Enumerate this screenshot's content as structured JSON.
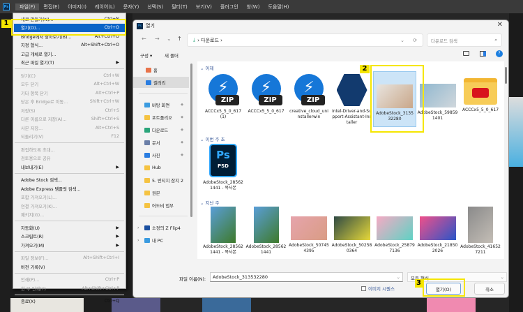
{
  "app": {
    "logo": "Ps"
  },
  "menubar": [
    "파일(F)",
    "편집(E)",
    "이미지(I)",
    "레이어(L)",
    "문자(Y)",
    "선택(S)",
    "필터(T)",
    "보기(V)",
    "플러그인",
    "창(W)",
    "도움말(H)"
  ],
  "file_menu": [
    {
      "label": "새로 만들기(N)...",
      "shortcut": "Ctrl+N"
    },
    {
      "label": "열기(O)...",
      "shortcut": "Ctrl+O",
      "highlighted": true
    },
    {
      "label": "Bridge에서 찾아보기(B)...",
      "shortcut": "Alt+Ctrl+O"
    },
    {
      "label": "지정 형식...",
      "shortcut": "Alt+Shift+Ctrl+O"
    },
    {
      "label": "고급 개체로 열기..."
    },
    {
      "label": "최근 파일 열기(T)",
      "submenu": true
    },
    {
      "divider": true
    },
    {
      "label": "닫기(C)",
      "shortcut": "Ctrl+W",
      "disabled": true
    },
    {
      "label": "모두 닫기",
      "shortcut": "Alt+Ctrl+W",
      "disabled": true
    },
    {
      "label": "기타 항목 닫기",
      "shortcut": "Alt+Ctrl+P",
      "disabled": true
    },
    {
      "label": "닫은 후 Bridge로 이동...",
      "shortcut": "Shift+Ctrl+W",
      "disabled": true
    },
    {
      "label": "저장(S)",
      "shortcut": "Ctrl+S",
      "disabled": true
    },
    {
      "label": "다른 이름으로 저장(A)...",
      "shortcut": "Shift+Ctrl+S",
      "disabled": true
    },
    {
      "label": "사본 저장...",
      "shortcut": "Alt+Ctrl+S",
      "disabled": true
    },
    {
      "label": "되돌리기(V)",
      "shortcut": "F12",
      "disabled": true
    },
    {
      "divider": true
    },
    {
      "label": "편집하도록 초대...",
      "disabled": true
    },
    {
      "label": "검토용으로 공유",
      "disabled": true
    },
    {
      "label": "내보내기(E)",
      "submenu": true
    },
    {
      "divider": true
    },
    {
      "label": "Adobe Stock 검색..."
    },
    {
      "label": "Adobe Express 템플릿 검색..."
    },
    {
      "label": "포함 가져오기(L)...",
      "disabled": true
    },
    {
      "label": "연결 가져오기(K)...",
      "disabled": true
    },
    {
      "label": "패키지(G)...",
      "disabled": true
    },
    {
      "divider": true
    },
    {
      "label": "자동화(U)",
      "submenu": true
    },
    {
      "label": "스크립트(R)",
      "submenu": true
    },
    {
      "label": "가져오기(M)",
      "submenu": true
    },
    {
      "divider": true
    },
    {
      "label": "파일 정보(F)...",
      "shortcut": "Alt+Shift+Ctrl+I",
      "disabled": true
    },
    {
      "label": "버전 기록(V)"
    },
    {
      "divider": true
    },
    {
      "label": "인쇄(P)...",
      "shortcut": "Ctrl+P",
      "disabled": true
    },
    {
      "label": "한 부 인쇄(Y)",
      "shortcut": "Alt+Shift+Ctrl+P",
      "disabled": true
    },
    {
      "divider": true
    },
    {
      "label": "종료(X)",
      "shortcut": "Ctrl+Q"
    }
  ],
  "steps": [
    "1",
    "2",
    "3"
  ],
  "dialog": {
    "title": "열기",
    "close": "✕",
    "nav": {
      "back": "←",
      "forward": "→",
      "recent": "⌄",
      "up": "↑",
      "path_sep": "›",
      "path": "다운로드",
      "path_end": "›",
      "dropdown": "⌄",
      "refresh": "⟳"
    },
    "search_placeholder": "다운로드 검색",
    "toolbar": {
      "organize": "구성 ▾",
      "new_folder": "새 폴더",
      "help": "?"
    },
    "sidebar": [
      {
        "label": "홈",
        "icon": "home",
        "color": "#e8734a"
      },
      {
        "label": "갤러리",
        "icon": "gallery",
        "color": "#2a7de1",
        "selected": true
      },
      {
        "divider": true
      },
      {
        "label": "바탕 화면",
        "icon": "desktop",
        "color": "#3a9be0",
        "pinned": true
      },
      {
        "label": "포트폴리오",
        "icon": "folder",
        "color": "#f5c342",
        "pinned": true
      },
      {
        "label": "다운로드",
        "icon": "download",
        "color": "#2aa57a",
        "pinned": true
      },
      {
        "label": "문서",
        "icon": "document",
        "color": "#6b7fa8",
        "pinned": true
      },
      {
        "label": "사진",
        "icon": "pictures",
        "color": "#2a7de1",
        "pinned": true
      },
      {
        "label": "Hub",
        "icon": "folder",
        "color": "#f5c342"
      },
      {
        "label": "5. 빈티지 잡지 2",
        "icon": "folder",
        "color": "#f5c342"
      },
      {
        "label": "원본",
        "icon": "folder",
        "color": "#f5c342"
      },
      {
        "label": "어도비 업무",
        "icon": "folder",
        "color": "#f5c342"
      },
      {
        "divider": true
      },
      {
        "label": "소정의 Z Flip4",
        "icon": "phone",
        "color": "#1a4fa0",
        "expander": true
      },
      {
        "label": "내 PC",
        "icon": "pc",
        "color": "#3a9be0",
        "expander": true
      }
    ],
    "sections": [
      {
        "title": "어제",
        "files": [
          {
            "name": "ACCCx5_5_0_617 (1)",
            "type": "zip"
          },
          {
            "name": "ACCCx5_5_0_617",
            "type": "zip"
          },
          {
            "name": "creative_cloud_uninstallerwin",
            "type": "zip"
          },
          {
            "name": "Intel-Driver-and-Support-Assistant-Installer",
            "type": "intel"
          },
          {
            "name": "AdobeStock_313532280",
            "type": "photo",
            "colors": [
              "#e8e4de",
              "#c9a78a"
            ],
            "selected": true
          },
          {
            "name": "AdobeStock_598591401",
            "type": "photo",
            "colors": [
              "#8fb7cf",
              "#d0d7dc"
            ]
          },
          {
            "name": "ACCCx5_5_0_617",
            "type": "folder"
          }
        ]
      },
      {
        "title": "이번 주 초",
        "files": [
          {
            "name": "AdobeStock_285621441 - 복사본",
            "type": "psd",
            "text": "Ps",
            "sub": "PSD"
          }
        ]
      },
      {
        "title": "지난 주",
        "files": [
          {
            "name": "AdobeStock_285621441 - 복사본",
            "type": "photo",
            "colors": [
              "#5a9ed8",
              "#3e7a2a"
            ],
            "tall": true
          },
          {
            "name": "AdobeStock_285621441",
            "type": "photo",
            "colors": [
              "#5a9ed8",
              "#3e7a2a"
            ],
            "tall": true
          },
          {
            "name": "AdobeStock_507454395",
            "type": "photo",
            "colors": [
              "#e6a4ac",
              "#d99c84"
            ]
          },
          {
            "name": "AdobeStock_502580364",
            "type": "photo",
            "colors": [
              "#2f4a44",
              "#e6d83a"
            ]
          },
          {
            "name": "AdobeStock_258797136",
            "type": "photo",
            "colors": [
              "#f6aac4",
              "#5fd2c4"
            ]
          },
          {
            "name": "AdobeStock_218502026",
            "type": "photo",
            "colors": [
              "#f0508a",
              "#2a55c8"
            ]
          },
          {
            "name": "AdobeStock_416527211",
            "type": "photo",
            "colors": [
              "#8a8a8a",
              "#c4beb6"
            ],
            "tall": true
          }
        ]
      }
    ],
    "filename_label": "파일 이름(N):",
    "filename_value": "AdobeStock_313532280",
    "filetype": "모든 형식",
    "image_sequence": "이미지 시퀀스",
    "open_button": "열기(O)",
    "cancel_button": "취소"
  },
  "colors": {
    "highlight": "#0a64c8",
    "annotation": "#f5e600",
    "selection": "#cce4f7"
  }
}
